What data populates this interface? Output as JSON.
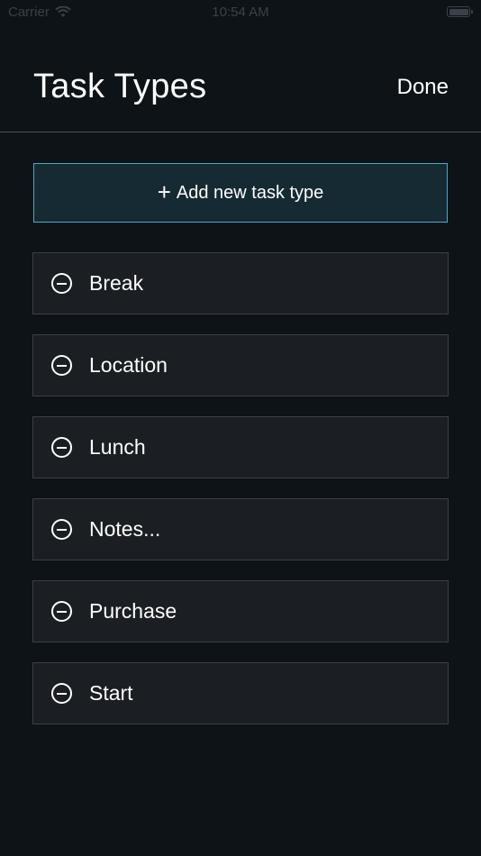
{
  "status_bar": {
    "carrier": "Carrier",
    "time": "10:54 AM"
  },
  "header": {
    "title": "Task Types",
    "done_label": "Done"
  },
  "add_button": {
    "icon": "+",
    "label": "Add new task type"
  },
  "task_types": [
    {
      "label": "Break"
    },
    {
      "label": "Location"
    },
    {
      "label": "Lunch"
    },
    {
      "label": "Notes..."
    },
    {
      "label": "Purchase"
    },
    {
      "label": "Start"
    }
  ],
  "colors": {
    "background": "#0d1317",
    "accent": "#4aa8c8",
    "row_background": "#1b1f23"
  }
}
